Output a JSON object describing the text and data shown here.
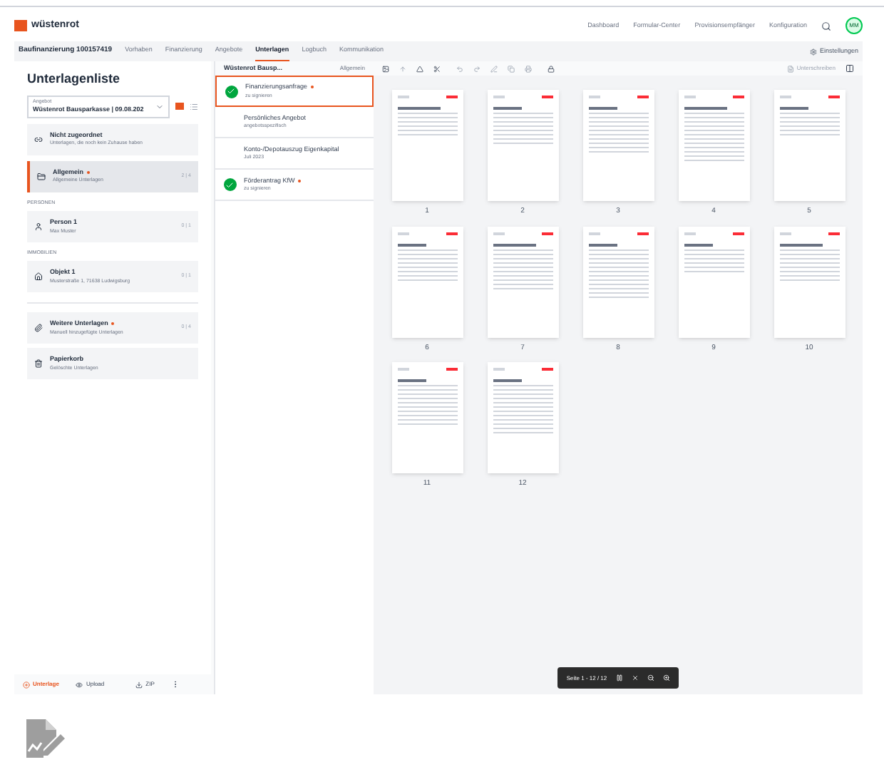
{
  "header": {
    "logo": "wüstenrot",
    "nav": [
      "Dashboard",
      "Formular-Center",
      "Provisionsempfänger",
      "Konfiguration"
    ],
    "avatar": "MM"
  },
  "subnav": {
    "title": "Baufinanzierung 100157419",
    "tabs": [
      {
        "label": "Vorhaben",
        "selected": false
      },
      {
        "label": "Finanzierung",
        "selected": false
      },
      {
        "label": "Angebote",
        "selected": false
      },
      {
        "label": "Unterlagen",
        "selected": true
      },
      {
        "label": "Logbuch",
        "selected": false
      },
      {
        "label": "Kommunikation",
        "selected": false
      }
    ],
    "settings": "Einstellungen"
  },
  "sidebar": {
    "title": "Unterlagenliste",
    "select": {
      "label": "Angebot",
      "value": "Wüstenrot Bausparkasse | 09.08.202"
    },
    "groups": [
      {
        "items": [
          {
            "kind": "link",
            "title": "Nicht zugeordnet",
            "dot": false,
            "subtitle": "Unterlagen, die noch kein Zuhause haben",
            "selected": false
          }
        ]
      },
      {
        "items": [
          {
            "kind": "folder",
            "title": "Allgemein",
            "dot": true,
            "subtitle": "Allgemeine Unterlagen",
            "count": "2 | 4",
            "selected": true
          }
        ]
      },
      {
        "heading": "PERSONEN",
        "items": [
          {
            "kind": "person",
            "title": "Person 1",
            "dot": false,
            "subtitle": "Max Muster",
            "count": "0 | 1",
            "selected": false
          }
        ]
      },
      {
        "heading": "IMMOBILIEN",
        "items": [
          {
            "kind": "house",
            "title": "Objekt 1",
            "dot": false,
            "subtitle": "Musterstraße 1, 71638 Ludwigsburg",
            "count": "0 | 1",
            "selected": false
          }
        ]
      },
      {
        "divider": true,
        "items": [
          {
            "kind": "clip",
            "title": "Weitere Unterlagen",
            "dot": true,
            "subtitle": "Manuell hinzugefügte Unterlagen",
            "count": "0 | 4",
            "selected": false
          },
          {
            "kind": "trash",
            "title": "Papierkorb",
            "dot": false,
            "subtitle": "Gelöschte Unterlagen",
            "selected": false
          }
        ]
      }
    ],
    "actions": [
      {
        "kind": "add",
        "label": "Unterlage"
      },
      {
        "kind": "upload",
        "label": "Upload"
      },
      {
        "kind": "download",
        "label": "ZIP"
      },
      {
        "kind": "more"
      }
    ]
  },
  "documents": {
    "header": "Wüstenrot Bausp...",
    "filter": "Allgemein",
    "items": [
      {
        "title": "Finanzierungsanfrage",
        "dot": true,
        "subtitle": "zu signieren",
        "done": true,
        "selected": true
      },
      {
        "title": "Persönliches Angebot",
        "dot": false,
        "subtitle": "angebotsspezifisch",
        "done": false,
        "selected": false
      },
      {
        "title": "Konto-/Depotauszug Eigenkapital",
        "dot": false,
        "subtitle": "Juli 2023",
        "done": false,
        "selected": false
      },
      {
        "title": "Förderantrag KfW",
        "dot": true,
        "subtitle": "zu signieren",
        "done": true,
        "selected": false
      }
    ]
  },
  "viewer": {
    "sign_button": "Unterschreiben",
    "pages": [
      "1",
      "2",
      "3",
      "4",
      "5",
      "6",
      "7",
      "8",
      "9",
      "10",
      "11",
      "12"
    ],
    "pager": "Seite 1 - 12 / 12"
  }
}
